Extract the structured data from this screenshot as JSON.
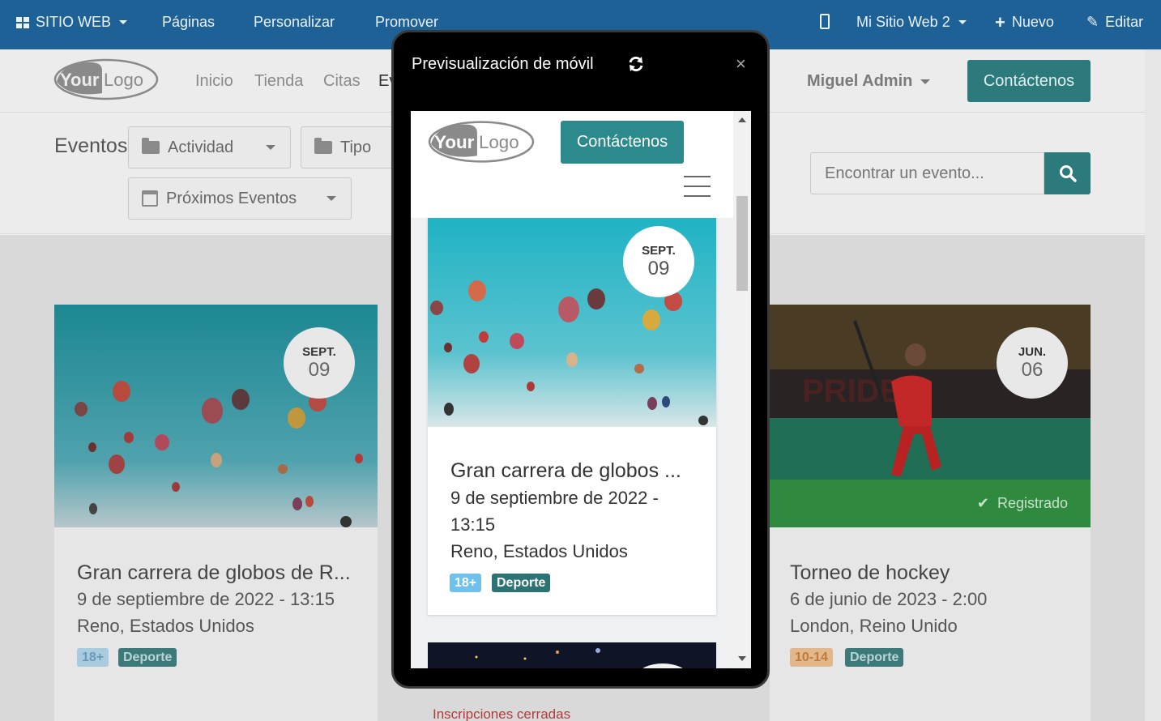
{
  "topbar": {
    "site_menu": "SITIO WEB",
    "pages": "Páginas",
    "customize": "Personalizar",
    "promote": "Promover",
    "website_name": "Mi Sitio Web 2",
    "new": "Nuevo",
    "edit": "Editar"
  },
  "header": {
    "logo_text_bold": "Your",
    "logo_text_light": "Logo",
    "menu": [
      "Inicio",
      "Tienda",
      "Citas",
      "Ev"
    ],
    "user": "Miguel Admin",
    "contact": "Contáctenos"
  },
  "filters": {
    "title": "Eventos",
    "activity": "Actividad",
    "type": "Tipo",
    "upcoming": "Próximos Eventos",
    "search_placeholder": "Encontrar un evento..."
  },
  "cards": [
    {
      "month": "SEPT.",
      "day": "09",
      "title": "Gran carrera de globos de R...",
      "date": "9 de septiembre de 2022 - 13:15",
      "location": "Reno, Estados Unidos",
      "badges": [
        "18+",
        "Deporte"
      ]
    },
    {
      "month": "JUN.",
      "day": "06",
      "title": "Torneo de hockey",
      "date": "6 de junio de 2023 - 2:00",
      "location": "London, Reino Unido",
      "badges": [
        "10-14",
        "Deporte"
      ],
      "status": "Registrado"
    }
  ],
  "middle_card_status": "Inscripciones cerradas",
  "mobile_preview": {
    "title": "Previsualización de móvil",
    "close": "×",
    "contact": "Contáctenos",
    "card": {
      "month": "SEPT.",
      "day": "09",
      "title": "Gran carrera de globos ...",
      "date_line1": "9 de septiembre de 2022 -",
      "date_line2": "13:15",
      "location": "Reno, Estados Unidos",
      "badges": [
        "18+",
        "Deporte"
      ]
    }
  },
  "colors": {
    "topbar": "#1e6196",
    "primary": "#2c7a7b",
    "registered": "#2f8a3f",
    "badge_age": "#6fb3d9",
    "badge_sport": "#2d7373",
    "badge_age_orange": "#e2a56a"
  }
}
